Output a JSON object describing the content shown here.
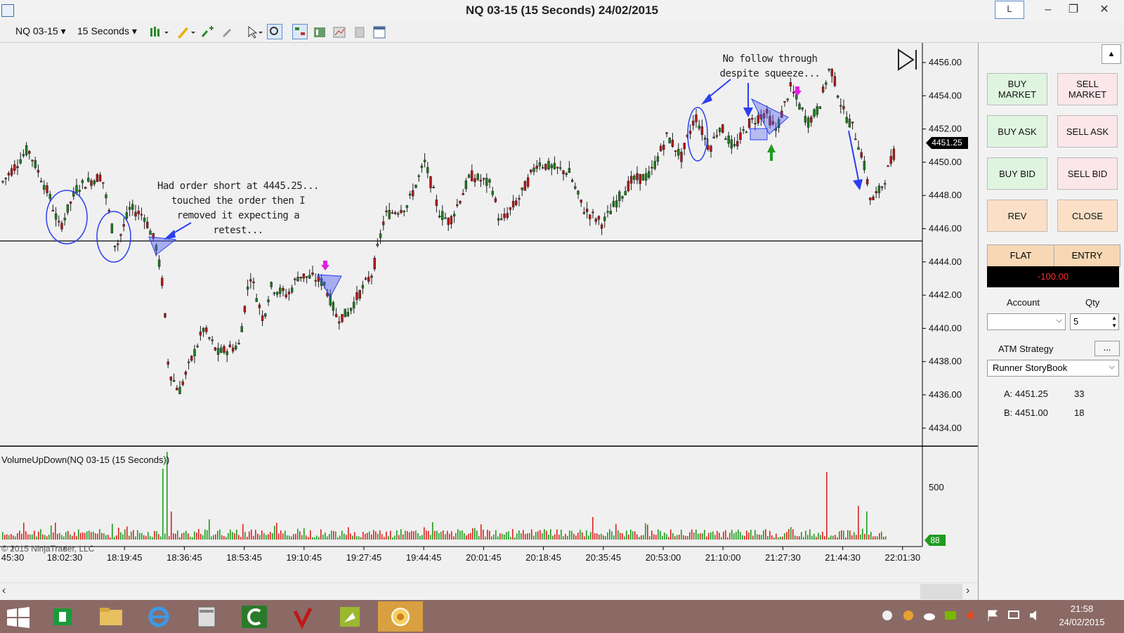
{
  "window": {
    "title": "NQ 03-15 (15 Seconds)  24/02/2015",
    "l_button": "L",
    "minimize": "–",
    "restore": "❐",
    "close": "✕"
  },
  "toolbar": {
    "instrument": "NQ 03-15",
    "interval": "15 Seconds"
  },
  "price_axis": {
    "labels": [
      "4456.00",
      "4454.00",
      "4452.00",
      "4450.00",
      "4448.00",
      "4446.00",
      "4444.00",
      "4442.00",
      "4440.00",
      "4438.00",
      "4436.00",
      "4434.00"
    ],
    "current": "4451.25"
  },
  "volume_panel": {
    "title": "VolumeUpDown(NQ 03-15 (15 Seconds))",
    "axis": [
      "500",
      "0"
    ],
    "current": "88",
    "copyright": "© 2015 NinjaTrader, LLC"
  },
  "time_axis": [
    "45:30",
    "18:02:30",
    "18:19:45",
    "18:36:45",
    "18:53:45",
    "19:10:45",
    "19:27:45",
    "19:44:45",
    "20:01:45",
    "20:18:45",
    "20:35:45",
    "20:53:00",
    "21:10:00",
    "21:27:30",
    "21:44:30",
    "22:01:30"
  ],
  "annotations": {
    "left": [
      "Had order short at 4445.25...",
      "touched the order then I",
      "removed it expecting a retest..."
    ],
    "right": [
      "No follow through",
      "despite squeeze..."
    ]
  },
  "order_panel": {
    "buy_market": [
      "BUY",
      "MARKET"
    ],
    "sell_market": [
      "SELL",
      "MARKET"
    ],
    "buy_ask": "BUY ASK",
    "sell_ask": "SELL ASK",
    "buy_bid": "BUY BID",
    "sell_bid": "SELL BID",
    "rev": "REV",
    "close": "CLOSE",
    "position": "FLAT",
    "entry": "ENTRY",
    "pnl": "-100.00",
    "account_label": "Account",
    "qty_label": "Qty",
    "qty_value": "5",
    "atm_label": "ATM Strategy",
    "atm_button": "...",
    "atm_value": "Runner StoryBook",
    "ask": "A: 4451.25",
    "ask_size": "33",
    "bid": "B: 4451.00",
    "bid_size": "18"
  },
  "taskbar": {
    "time": "21:58",
    "date": "24/02/2015"
  },
  "colors": {
    "up_volume": "#1f9b1f",
    "down_volume": "#e02020",
    "annotation": "#2a3ff0",
    "chart_bg": "#f0f0f0"
  }
}
